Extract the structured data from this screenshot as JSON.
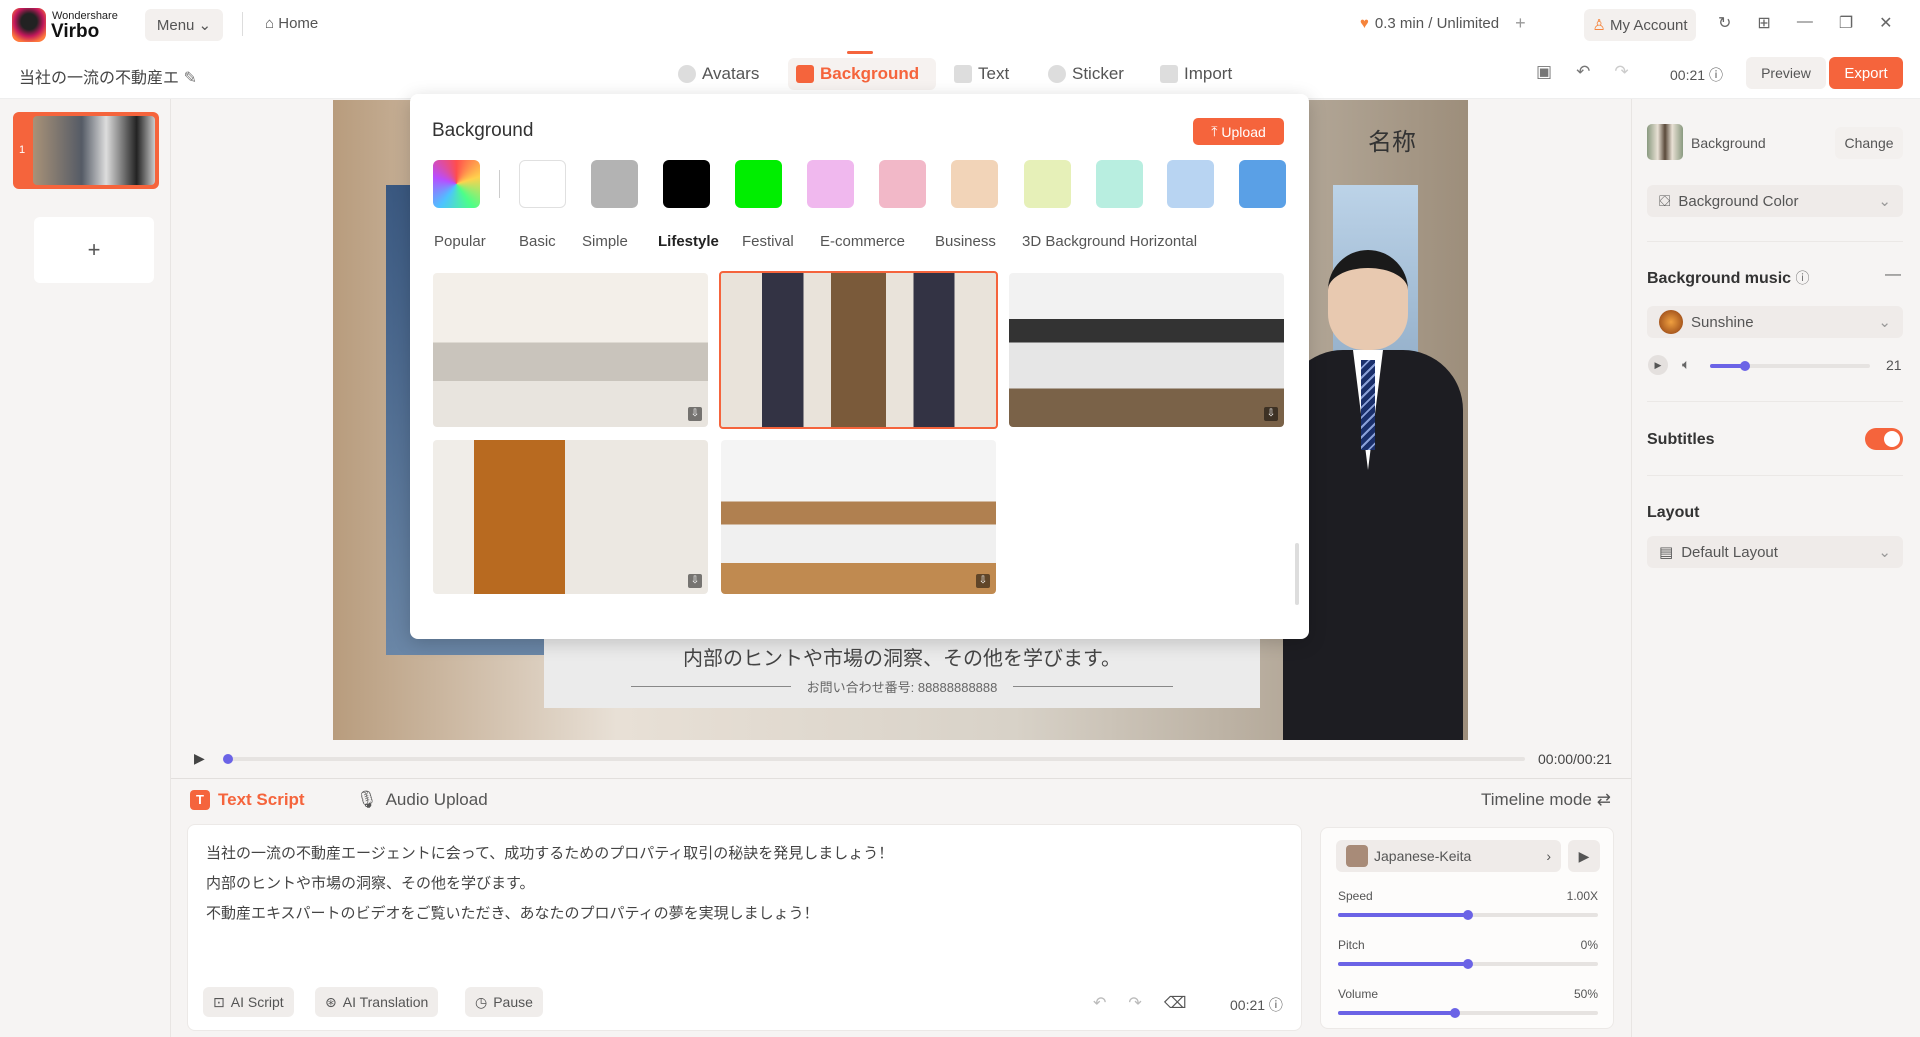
{
  "app": {
    "brand_top": "Wondershare",
    "brand_name": "Virbo",
    "menu": "Menu",
    "home": "Home",
    "usage": "0.3 min / Unlimited",
    "account": "My Account"
  },
  "project": {
    "title": "当社の一流の不動産エ",
    "time": "00:21",
    "preview": "Preview",
    "export": "Export"
  },
  "tabs": [
    {
      "label": "Avatars"
    },
    {
      "label": "Background"
    },
    {
      "label": "Text"
    },
    {
      "label": "Sticker"
    },
    {
      "label": "Import"
    }
  ],
  "slides": {
    "items": [
      {
        "number": "1"
      }
    ],
    "add": "+"
  },
  "popup": {
    "title": "Background",
    "upload": "Upload",
    "swatches": [
      "gradient",
      "#ffffff",
      "#b3b3b3",
      "#000000",
      "#00ee00",
      "#f0b8ee",
      "#f2b8c8",
      "#f2d4b8",
      "#e6f0b8",
      "#b8eee0",
      "#b8d4f2",
      "#5aa0e6"
    ],
    "categories": [
      "Popular",
      "Basic",
      "Simple",
      "Lifestyle",
      "Festival",
      "E-commerce",
      "Business",
      "3D Background Horizontal"
    ],
    "active_category": "Lifestyle"
  },
  "canvas": {
    "name_text": "名称",
    "subtitle": "内部のヒントや市場の洞察、その他を学びます。",
    "contact": "お問い合わせ番号:  88888888888"
  },
  "player": {
    "time": "00:00/00:21",
    "progress": 0
  },
  "script": {
    "tab_text": "Text Script",
    "tab_audio": "Audio Upload",
    "timeline": "Timeline mode",
    "lines": [
      "当社の一流の不動産エージェントに会って、成功するためのプロパティ取引の秘訣を発見しましょう！",
      "内部のヒントや市場の洞察、その他を学びます。",
      "不動産エキスパートのビデオをご覧いただき、あなたのプロパティの夢を実現しましょう！"
    ],
    "ai_script": "AI Script",
    "ai_translation": "AI Translation",
    "pause": "Pause",
    "duration": "00:21"
  },
  "voice": {
    "name": "Japanese-Keita",
    "speed_label": "Speed",
    "speed": "1.00X",
    "speed_pct": 50,
    "pitch_label": "Pitch",
    "pitch": "0%",
    "pitch_pct": 50,
    "volume_label": "Volume",
    "volume": "50%",
    "volume_pct": 45
  },
  "right": {
    "bg_label": "Background",
    "change": "Change",
    "bg_color": "Background Color",
    "music_title": "Background music",
    "music": "Sunshine",
    "music_volume": "21",
    "music_pct": 22,
    "subtitles": "Subtitles",
    "subtitles_on": true,
    "layout_title": "Layout",
    "layout": "Default Layout"
  },
  "colors": {
    "accent": "#f5643c",
    "slider": "#6b63e6"
  }
}
